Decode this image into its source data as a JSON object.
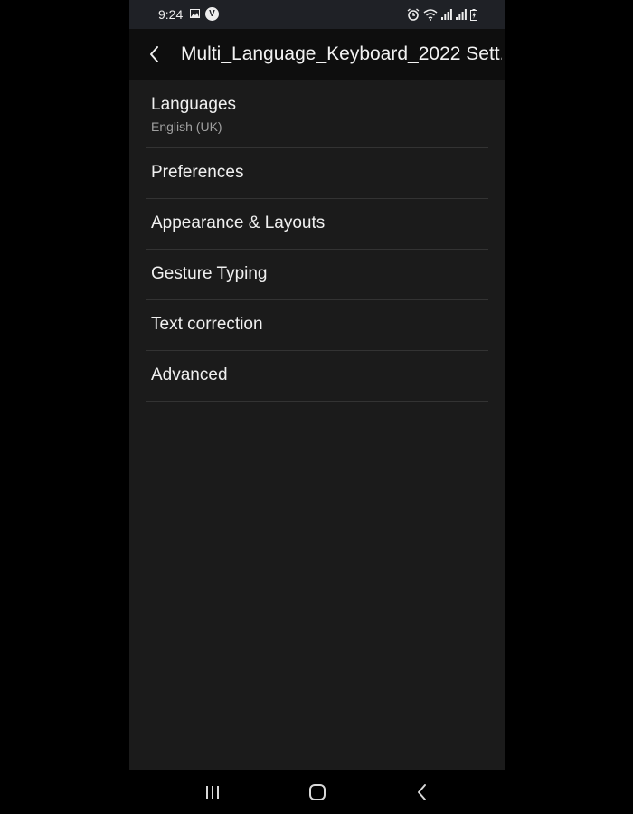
{
  "status_bar": {
    "time": "9:24",
    "icons_left": [
      "gallery-icon",
      "v-badge-icon"
    ],
    "v_badge": "V",
    "icons_right": [
      "alarm-icon",
      "wifi-icon",
      "signal-icon",
      "signal-icon",
      "battery-icon"
    ]
  },
  "app_bar": {
    "title": "Multi_Language_Keyboard_2022 Sett...",
    "back_icon": "chevron-left-icon"
  },
  "settings": {
    "items": [
      {
        "title": "Languages",
        "subtitle": "English (UK)"
      },
      {
        "title": "Preferences"
      },
      {
        "title": "Appearance & Layouts"
      },
      {
        "title": "Gesture Typing"
      },
      {
        "title": "Text correction"
      },
      {
        "title": "Advanced"
      }
    ]
  },
  "nav_bar": {
    "buttons": [
      "recents-icon",
      "home-icon",
      "back-icon"
    ]
  },
  "colors": {
    "background": "#1b1b1b",
    "app_bar": "#0e0e0e",
    "status_bar": "#1f2126",
    "divider": "#333333",
    "primary_text": "#f0f0f0",
    "secondary_text": "#a0a0a0"
  }
}
